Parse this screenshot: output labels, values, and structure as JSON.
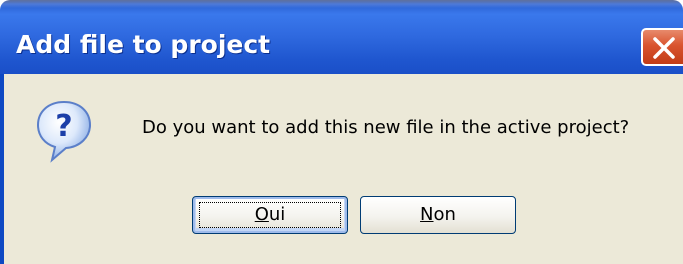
{
  "window": {
    "title": "Add file to project"
  },
  "dialog": {
    "icon": "question-icon",
    "message": "Do you want to add this new file in the active project?"
  },
  "buttons": {
    "yes": {
      "mnemonic": "O",
      "rest": "ui",
      "default": true
    },
    "no": {
      "mnemonic": "N",
      "rest": "on",
      "default": false
    }
  },
  "colors": {
    "titlebar": "#2f69df",
    "client_background": "#ece9d8",
    "close_button": "#d9542f"
  }
}
